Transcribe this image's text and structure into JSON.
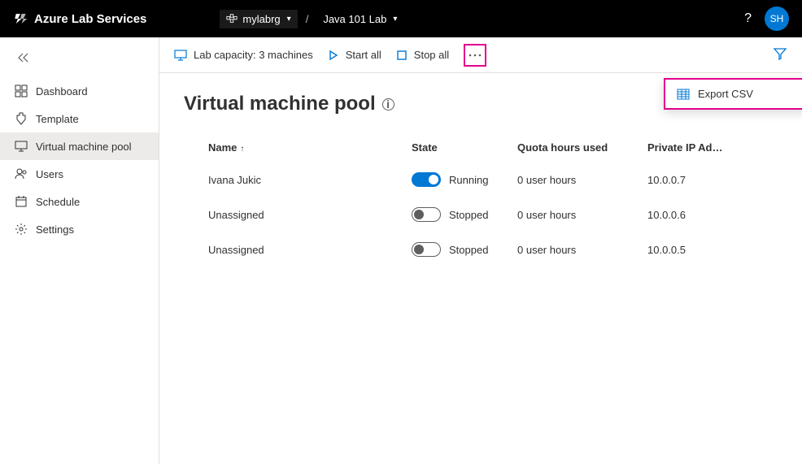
{
  "header": {
    "product": "Azure Lab Services",
    "resource_group": "mylabrg",
    "lab_name": "Java 101 Lab",
    "avatar_initials": "SH"
  },
  "sidebar": {
    "items": [
      {
        "label": "Dashboard"
      },
      {
        "label": "Template"
      },
      {
        "label": "Virtual machine pool"
      },
      {
        "label": "Users"
      },
      {
        "label": "Schedule"
      },
      {
        "label": "Settings"
      }
    ]
  },
  "toolbar": {
    "capacity": "Lab capacity: 3 machines",
    "start_all": "Start all",
    "stop_all": "Stop all",
    "export_csv": "Export CSV"
  },
  "page": {
    "title": "Virtual machine pool"
  },
  "table": {
    "cols": {
      "name": "Name",
      "state": "State",
      "quota": "Quota hours used",
      "ip": "Private IP Ad…"
    },
    "rows": [
      {
        "name": "Ivana Jukic",
        "running": true,
        "state_label": "Running",
        "quota": "0 user hours",
        "ip": "10.0.0.7"
      },
      {
        "name": "Unassigned",
        "running": false,
        "state_label": "Stopped",
        "quota": "0 user hours",
        "ip": "10.0.0.6"
      },
      {
        "name": "Unassigned",
        "running": false,
        "state_label": "Stopped",
        "quota": "0 user hours",
        "ip": "10.0.0.5"
      }
    ]
  }
}
